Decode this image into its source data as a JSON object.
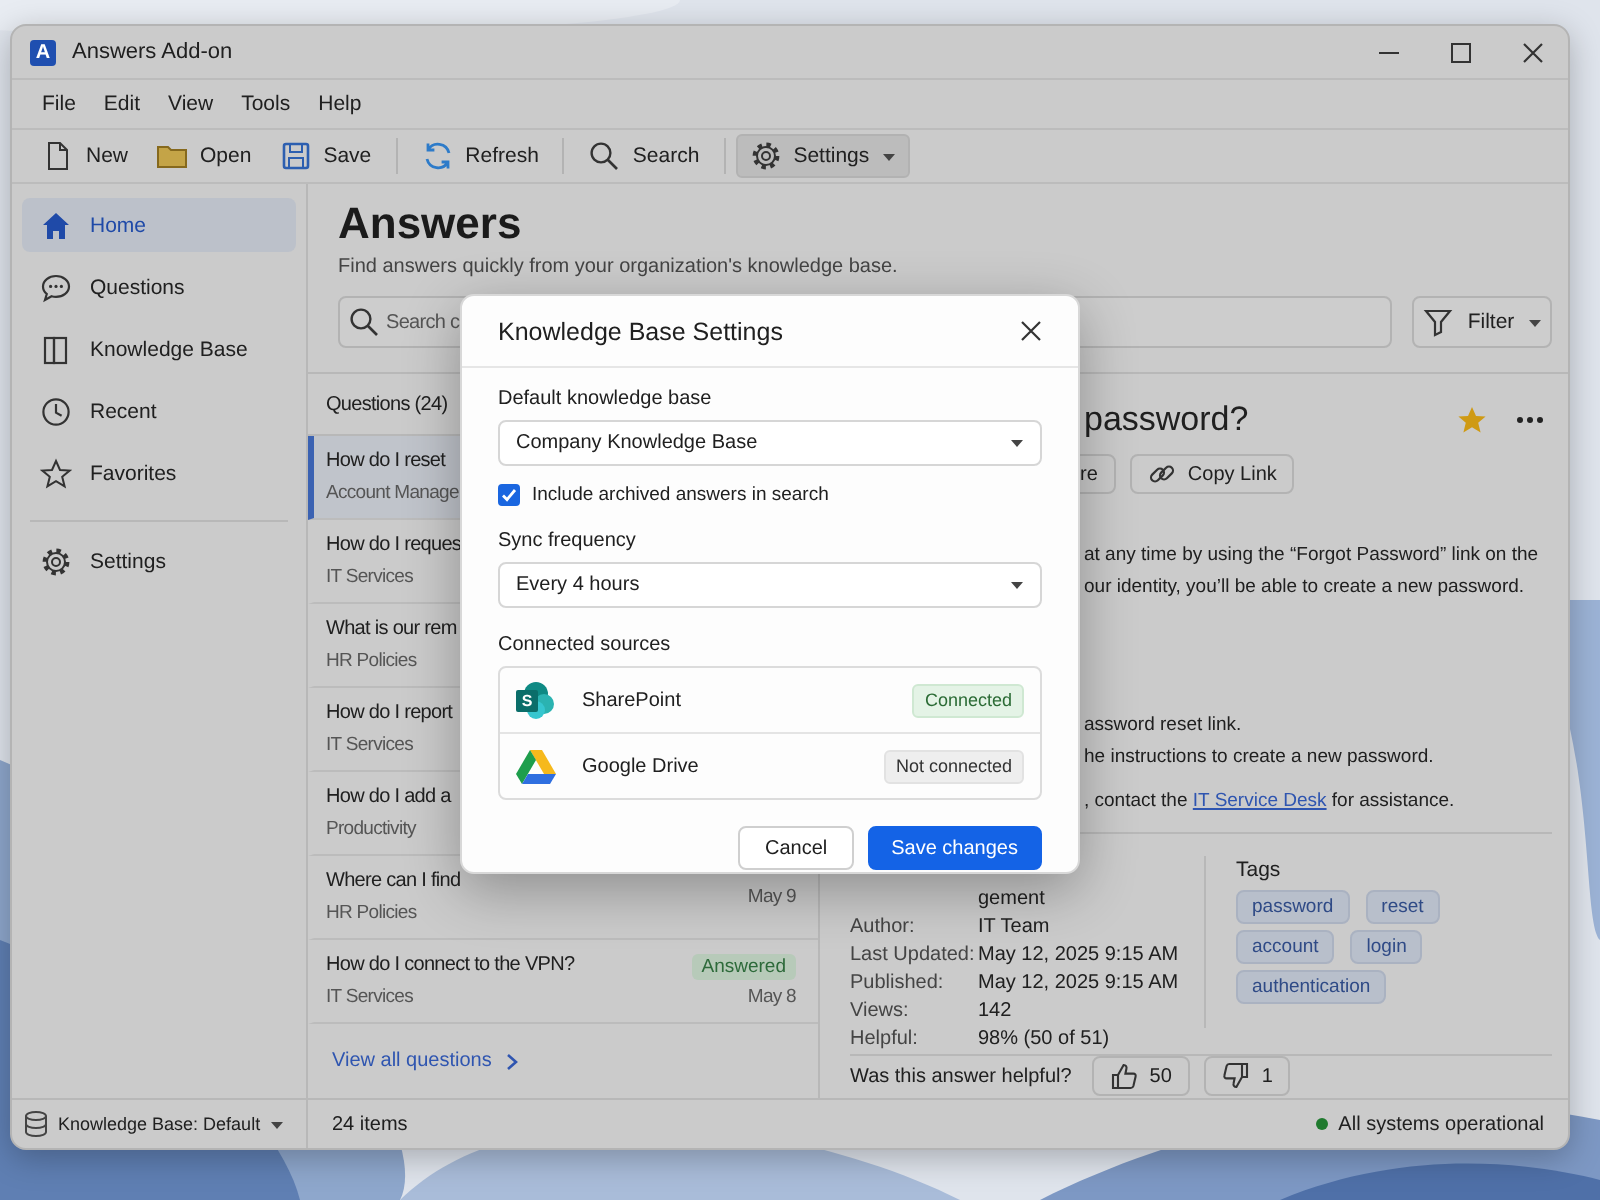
{
  "window": {
    "logo": "A",
    "title": "Answers Add-on"
  },
  "menu": [
    "File",
    "Edit",
    "View",
    "Tools",
    "Help"
  ],
  "toolbar": [
    [
      {
        "label": "New",
        "kind": "new",
        "active": false,
        "dropdown": false
      },
      {
        "label": "Open",
        "kind": "open",
        "active": false,
        "dropdown": false
      },
      {
        "label": "Save",
        "kind": "save",
        "active": false,
        "dropdown": false
      }
    ],
    [
      {
        "label": "Refresh",
        "kind": "refresh",
        "active": false,
        "dropdown": false
      }
    ],
    [
      {
        "label": "Search",
        "kind": "search",
        "active": false,
        "dropdown": false
      }
    ],
    [
      {
        "label": "Settings",
        "kind": "settings",
        "active": true,
        "dropdown": true
      }
    ]
  ],
  "sidebar": {
    "items": [
      {
        "label": "Home",
        "kind": "home",
        "selected": true
      },
      {
        "label": "Questions",
        "kind": "chat",
        "selected": false
      },
      {
        "label": "Knowledge Base",
        "kind": "book",
        "selected": false
      },
      {
        "label": "Recent",
        "kind": "clock",
        "selected": false
      },
      {
        "label": "Favorites",
        "kind": "star",
        "selected": false
      }
    ],
    "bottom_items": [
      {
        "label": "Settings",
        "kind": "settings",
        "selected": false
      }
    ],
    "footer": {
      "label": "Knowledge Base: Default"
    }
  },
  "header": {
    "title": "Answers",
    "subtitle": "Find answers quickly from your organization's knowledge base.",
    "search": {
      "placeholder": "Search c"
    },
    "filter": {
      "label": "Filter"
    }
  },
  "questions": {
    "heading": "Questions (24)",
    "items": [
      {
        "title": "How do I reset",
        "category": "Account Manage",
        "selected": true
      },
      {
        "title": "How do I reques",
        "category": "IT Services",
        "selected": false
      },
      {
        "title": "What is our rem",
        "category": "HR Policies",
        "selected": false
      },
      {
        "title": "How do I report",
        "category": "IT Services",
        "selected": false
      },
      {
        "title": "How do I add a",
        "category": "Productivity",
        "selected": false
      },
      {
        "title": "Where can I find",
        "category": "HR Policies",
        "date": "May 9",
        "selected": false
      },
      {
        "title": "How do I connect to the VPN?",
        "category": "IT Services",
        "status": "Answered",
        "date": "May 8",
        "selected": false
      }
    ],
    "footer_link": "View all questions"
  },
  "answer": {
    "title": "password?",
    "favorite": true,
    "actions": [
      {
        "label": "re",
        "kind": "share"
      },
      {
        "label": "Copy Link",
        "kind": "link"
      }
    ],
    "blocks": [
      [
        {
          "text": "at any time by using the “Forgot Password” link on the"
        },
        {
          "text": "our identity, you’ll be able to create a new password."
        }
      ],
      [
        {
          "text": "assword reset link."
        },
        {
          "text": "he instructions to create a new password."
        }
      ],
      [
        {
          "text": ", contact the ",
          "link": "IT Service Desk",
          "after": " for assistance."
        }
      ]
    ],
    "meta": [
      {
        "value": "gement"
      },
      {
        "label": "Author:",
        "value": "IT Team"
      },
      {
        "label": "Last Updated:",
        "value": "May 12, 2025 9:15 AM"
      },
      {
        "label": "Published:",
        "value": "May 12, 2025 9:15 AM"
      },
      {
        "label": "Views:",
        "value": "142"
      },
      {
        "label": "Helpful:",
        "value": "98% (50 of 51)"
      }
    ],
    "tags": {
      "heading": "Tags",
      "items": [
        "password",
        "reset",
        "account",
        "login",
        "authentication"
      ]
    },
    "feedback": {
      "question": "Was this answer helpful?",
      "up": "50",
      "down": "1"
    }
  },
  "status_bar": {
    "count": "24 items",
    "system": "All systems operational"
  },
  "dialog": {
    "title": "Knowledge Base Settings",
    "fields": [
      {
        "kind": "select",
        "label": "Default knowledge base",
        "value": "Company Knowledge Base"
      },
      {
        "kind": "checkbox",
        "label": "Include archived answers in search",
        "checked": true
      },
      {
        "kind": "select",
        "label": "Sync frequency",
        "value": "Every 4 hours"
      }
    ],
    "sources": {
      "heading": "Connected sources",
      "items": [
        {
          "name": "SharePoint",
          "kind": "sharepoint",
          "logo_letter": "S",
          "status": "Connected",
          "connected": true
        },
        {
          "name": "Google Drive",
          "kind": "drive",
          "status": "Not connected",
          "connected": false
        }
      ]
    },
    "buttons": [
      {
        "label": "Cancel",
        "kind": "secondary"
      },
      {
        "label": "Save changes",
        "kind": "primary"
      }
    ]
  }
}
